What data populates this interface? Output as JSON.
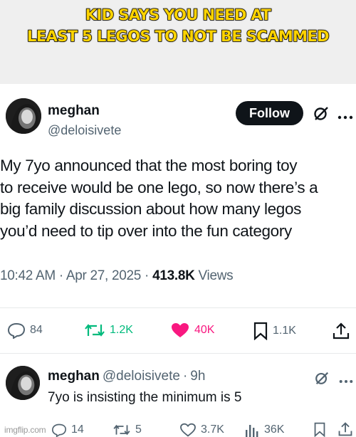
{
  "caption": "KID SAYS YOU NEED AT\nLEAST 5 LEGOS TO NOT BE SCAMMED",
  "tweet": {
    "name": "meghan",
    "handle": "@deloisivete",
    "follow_label": "Follow",
    "text": "My 7yo announced that the most boring toy\nto receive would be one lego, so now there’s a\nbig family discussion about how many legos\nyou’d need to tip over into the fun category",
    "time": "10:42 AM",
    "date": "Apr 27, 2025",
    "views_count": "413.8K",
    "views_label": "Views",
    "actions": {
      "replies": "84",
      "reposts": "1.2K",
      "likes": "40K",
      "bookmarks": "1.1K"
    }
  },
  "reply": {
    "name": "meghan",
    "handle": "@deloisivete",
    "age": "9h",
    "text": "7yo is insisting the minimum is 5",
    "actions": {
      "replies": "14",
      "reposts": "5",
      "likes": "3.7K",
      "views": "36K"
    }
  },
  "watermark": "imgflip.com",
  "colors": {
    "caption": "#ffd400",
    "repost": "#00ba7c",
    "like": "#f91880",
    "follow_bg": "#0f1419",
    "muted": "#536471"
  }
}
